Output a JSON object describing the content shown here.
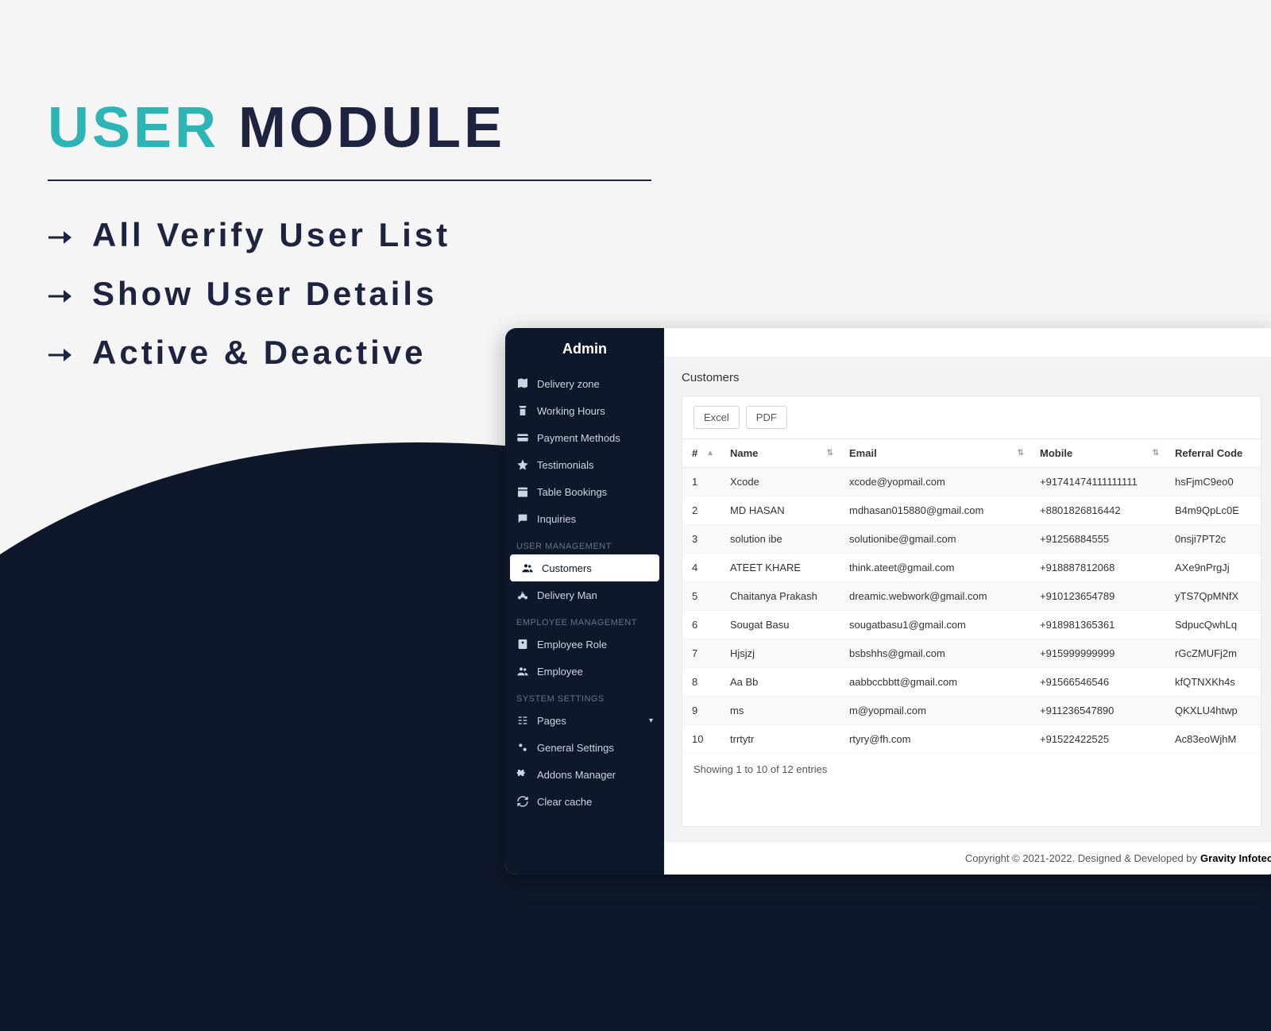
{
  "hero": {
    "title_accent": "USER",
    "title_rest": " MODULE",
    "items": [
      "All Verify User List",
      "Show User Details",
      "Active & Deactive"
    ]
  },
  "sidebar": {
    "brand": "Admin",
    "general": [
      {
        "icon": "map",
        "label": "Delivery zone"
      },
      {
        "icon": "clock",
        "label": "Working Hours"
      },
      {
        "icon": "card",
        "label": "Payment Methods"
      },
      {
        "icon": "star",
        "label": "Testimonials"
      },
      {
        "icon": "calendar",
        "label": "Table Bookings"
      },
      {
        "icon": "chat",
        "label": "Inquiries"
      }
    ],
    "section_user": "USER MANAGEMENT",
    "user": [
      {
        "icon": "users",
        "label": "Customers",
        "active": true
      },
      {
        "icon": "bike",
        "label": "Delivery Man"
      }
    ],
    "section_employee": "EMPLOYEE MANAGEMENT",
    "employee": [
      {
        "icon": "badge",
        "label": "Employee Role"
      },
      {
        "icon": "users",
        "label": "Employee"
      }
    ],
    "section_system": "SYSTEM SETTINGS",
    "system": [
      {
        "icon": "pages",
        "label": "Pages",
        "dropdown": true
      },
      {
        "icon": "gear",
        "label": "General Settings"
      },
      {
        "icon": "puzzle",
        "label": "Addons Manager"
      },
      {
        "icon": "refresh",
        "label": "Clear cache"
      }
    ]
  },
  "page": {
    "title": "Customers",
    "export_excel": "Excel",
    "export_pdf": "PDF",
    "headers": {
      "idx": "#",
      "name": "Name",
      "email": "Email",
      "mobile": "Mobile",
      "referral": "Referral Code"
    },
    "rows": [
      {
        "idx": "1",
        "name": "Xcode",
        "email": "xcode@yopmail.com",
        "mobile": "+91741474111111111",
        "referral": "hsFjmC9eo0"
      },
      {
        "idx": "2",
        "name": "MD HASAN",
        "email": "mdhasan015880@gmail.com",
        "mobile": "+8801826816442",
        "referral": "B4m9QpLc0E"
      },
      {
        "idx": "3",
        "name": "solution ibe",
        "email": "solutionibe@gmail.com",
        "mobile": "+91256884555",
        "referral": "0nsji7PT2c"
      },
      {
        "idx": "4",
        "name": "ATEET KHARE",
        "email": "think.ateet@gmail.com",
        "mobile": "+918887812068",
        "referral": "AXe9nPrgJj"
      },
      {
        "idx": "5",
        "name": "Chaitanya Prakash",
        "email": "dreamic.webwork@gmail.com",
        "mobile": "+910123654789",
        "referral": "yTS7QpMNfX"
      },
      {
        "idx": "6",
        "name": "Sougat Basu",
        "email": "sougatbasu1@gmail.com",
        "mobile": "+918981365361",
        "referral": "SdpucQwhLq"
      },
      {
        "idx": "7",
        "name": "Hjsjzj",
        "email": "bsbshhs@gmail.com",
        "mobile": "+915999999999",
        "referral": "rGcZMUFj2m"
      },
      {
        "idx": "8",
        "name": "Aa Bb",
        "email": "aabbccbbtt@gmail.com",
        "mobile": "+91566546546",
        "referral": "kfQTNXKh4s"
      },
      {
        "idx": "9",
        "name": "ms",
        "email": "m@yopmail.com",
        "mobile": "+911236547890",
        "referral": "QKXLU4htwp"
      },
      {
        "idx": "10",
        "name": "trrtytr",
        "email": "rtyry@fh.com",
        "mobile": "+91522422525",
        "referral": "Ac83eoWjhM"
      }
    ],
    "info": "Showing 1 to 10 of 12 entries"
  },
  "footer": {
    "copyright": "Copyright © 2021-2022. Designed & Developed by ",
    "company": "Gravity Infotech"
  }
}
